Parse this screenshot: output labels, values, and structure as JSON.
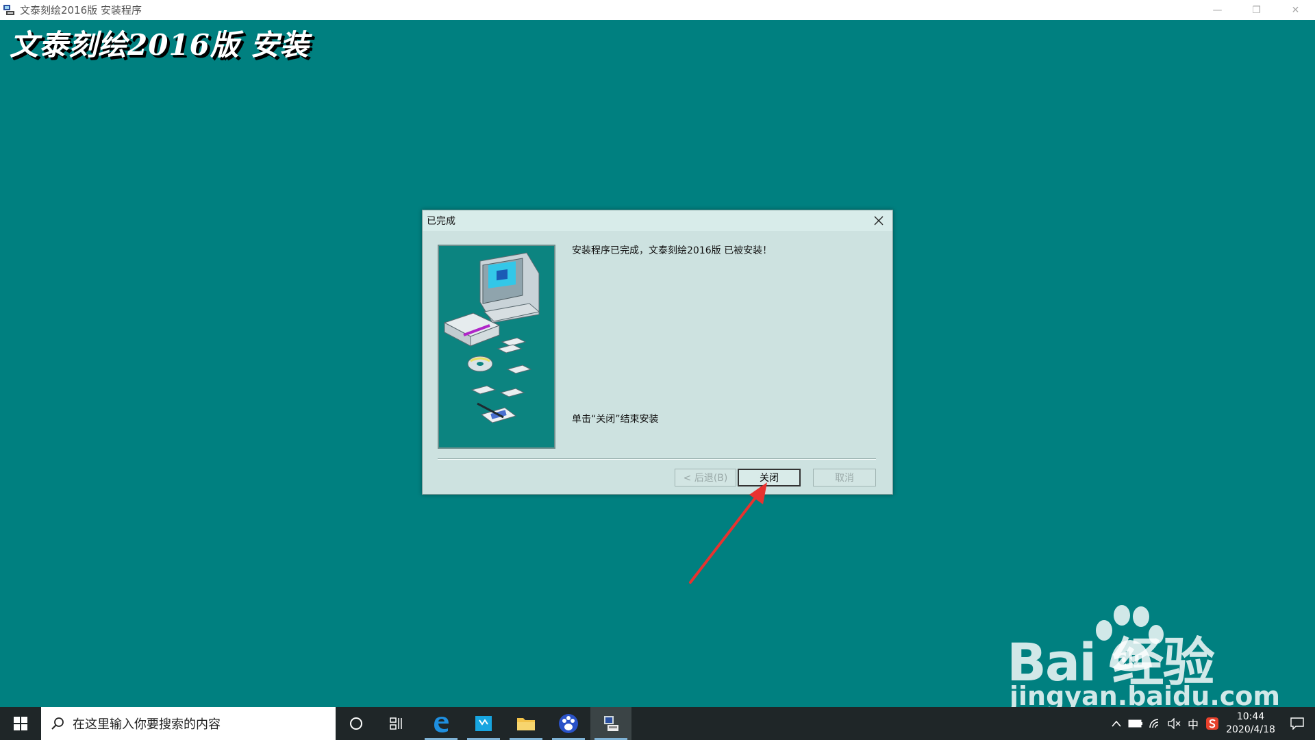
{
  "window": {
    "title": "文泰刻绘2016版 安装程序",
    "minimize_glyph": "—",
    "restore_glyph": "❐",
    "close_glyph": "✕"
  },
  "installer_title": "文泰刻绘2016版 安装",
  "dialog": {
    "title": "已完成",
    "message": "安装程序已完成，文泰刻绘2016版 已被安装！",
    "hint": "单击“关闭”结束安装",
    "buttons": {
      "back": "< 后退(B)",
      "close": "关闭",
      "cancel": "取消"
    }
  },
  "watermark": {
    "brand": "Bai  经验",
    "url": "jingyan.baidu.com"
  },
  "taskbar": {
    "search_placeholder": "在这里输入你要搜索的内容",
    "ime": "中",
    "time": "10:44",
    "date": "2020/4/18"
  },
  "colors": {
    "desktop": "#008080",
    "dialog_bg": "#cde2e0",
    "annotation_arrow": "#e8322f",
    "taskbar": "#1f2628"
  }
}
